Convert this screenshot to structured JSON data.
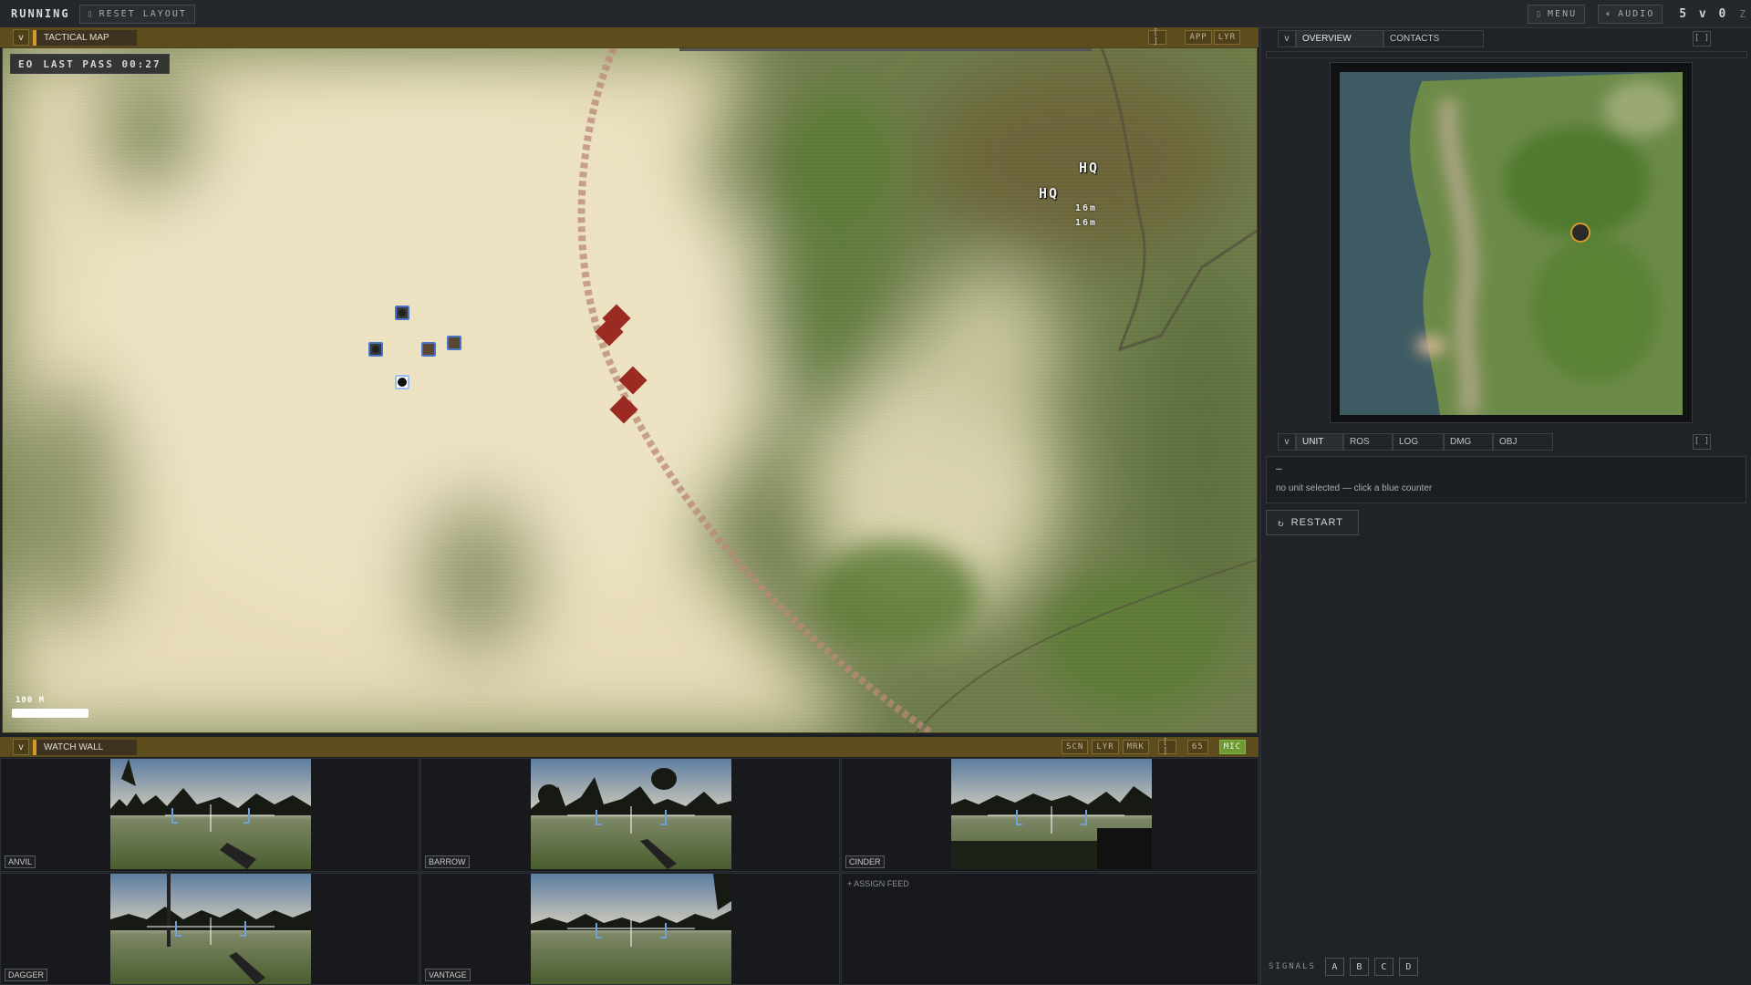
{
  "topbar": {
    "status": "RUNNING",
    "reset_label": "RESET LAYOUT",
    "menu_label": "MENU",
    "audio_label": "AUDIO",
    "score": "5 v 0",
    "corner_label": "Z"
  },
  "tactical_map": {
    "collapse": "v",
    "title": "TACTICAL MAP",
    "btn_frame": "[ ]",
    "btn_app": "APP",
    "btn_lyr": "LYR",
    "eo_label": "EO",
    "last_pass": "LAST PASS 00:27",
    "scale_text": "100 M",
    "hq1": "HQ",
    "hq2": "HQ",
    "range1": "16m",
    "range2": "16m"
  },
  "watch_wall": {
    "collapse": "v",
    "title": "WATCH WALL",
    "btn_scn": "SCN",
    "btn_lyr": "LYR",
    "btn_mrk": "MRK",
    "btn_frame": "[ ]",
    "btn_65": "65",
    "btn_mic": "MIC",
    "feeds": [
      {
        "name": "ANVIL"
      },
      {
        "name": "BARROW"
      },
      {
        "name": "CINDER"
      },
      {
        "name": "DAGGER"
      },
      {
        "name": "VANTAGE"
      }
    ],
    "assign_label": "+ ASSIGN FEED"
  },
  "overview": {
    "collapse": "v",
    "tab_overview": "OVERVIEW",
    "tab_contacts": "CONTACTS",
    "btn_frame": "[ ]"
  },
  "unit_panel": {
    "collapse": "v",
    "tabs": [
      "UNIT",
      "ROS",
      "LOG",
      "DMG",
      "OBJ"
    ],
    "btn_frame": "[ ]",
    "dash": "—",
    "message": "no unit selected — click a blue counter",
    "restart_label": "RESTART"
  },
  "signals": {
    "label": "SIGNALS",
    "buttons": [
      "A",
      "B",
      "C",
      "D"
    ]
  },
  "colors": {
    "accent": "#d19a2a",
    "hostile": "#9a2a22",
    "friendly": "#3d5fa8",
    "mic": "#6e9a34"
  }
}
